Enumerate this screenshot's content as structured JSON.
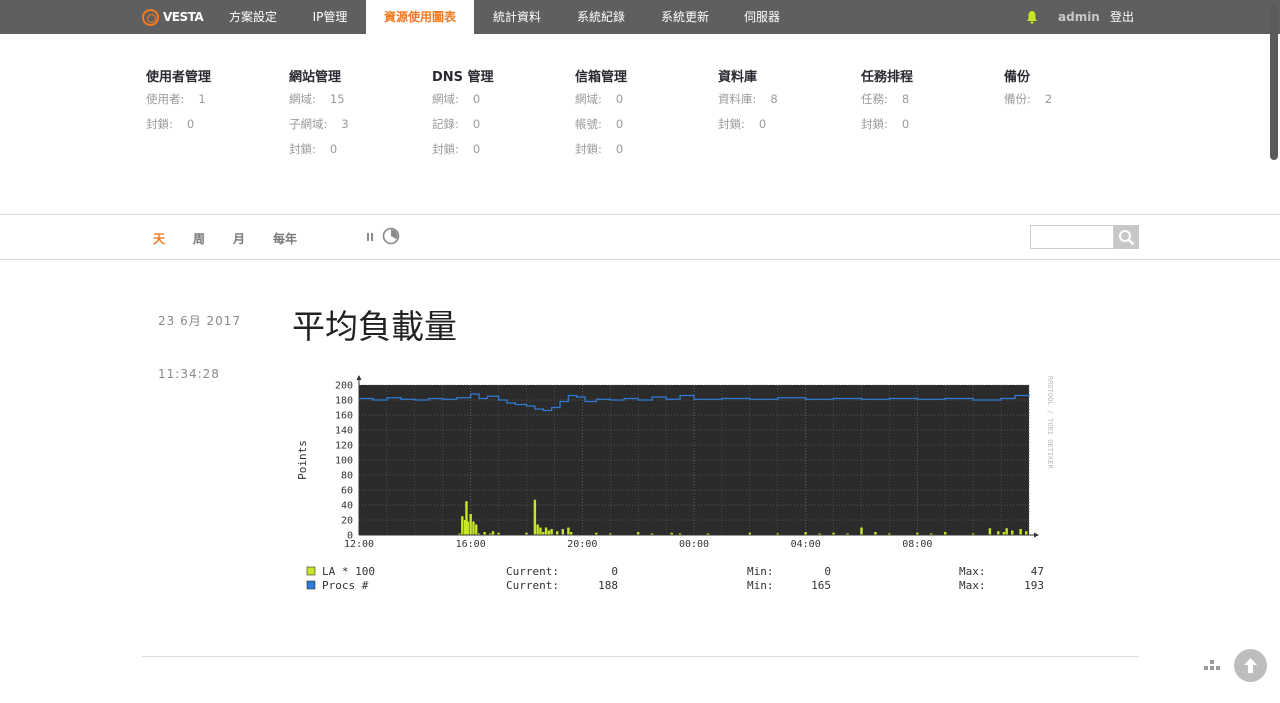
{
  "app": {
    "logo_text": "VESTA"
  },
  "nav": {
    "items": [
      {
        "label": "方案設定"
      },
      {
        "label": "IP管理"
      },
      {
        "label": "資源使用圖表",
        "active": true
      },
      {
        "label": "統計資料"
      },
      {
        "label": "系統紀錄"
      },
      {
        "label": "系統更新"
      },
      {
        "label": "伺服器"
      }
    ],
    "user": "admin",
    "logout": "登出"
  },
  "stats": [
    {
      "title": "使用者管理",
      "rows": [
        {
          "label": "使用者:",
          "value": "1"
        },
        {
          "label": "封鎖:",
          "value": "0"
        }
      ]
    },
    {
      "title": "網站管理",
      "rows": [
        {
          "label": "網域:",
          "value": "15"
        },
        {
          "label": "子網域:",
          "value": "3"
        },
        {
          "label": "封鎖:",
          "value": "0"
        }
      ]
    },
    {
      "title": "DNS 管理",
      "rows": [
        {
          "label": "網域:",
          "value": "0"
        },
        {
          "label": "記錄:",
          "value": "0"
        },
        {
          "label": "封鎖:",
          "value": "0"
        }
      ]
    },
    {
      "title": "信箱管理",
      "rows": [
        {
          "label": "網域:",
          "value": "0"
        },
        {
          "label": "帳號:",
          "value": "0"
        },
        {
          "label": "封鎖:",
          "value": "0"
        }
      ]
    },
    {
      "title": "資料庫",
      "rows": [
        {
          "label": "資料庫:",
          "value": "8"
        },
        {
          "label": "封鎖:",
          "value": "0"
        }
      ]
    },
    {
      "title": "任務排程",
      "rows": [
        {
          "label": "任務:",
          "value": "8"
        },
        {
          "label": "封鎖:",
          "value": "0"
        }
      ]
    },
    {
      "title": "備份",
      "rows": [
        {
          "label": "備份:",
          "value": "2"
        }
      ]
    }
  ],
  "toolbar": {
    "periods": [
      {
        "label": "天",
        "active": true
      },
      {
        "label": "周"
      },
      {
        "label": "月"
      },
      {
        "label": "每年"
      }
    ],
    "search_placeholder": ""
  },
  "content": {
    "date": "23  6月  2017",
    "time": "11:34:28",
    "title": "平均負載量"
  },
  "colors": {
    "accent": "#f37a20",
    "nav_bg": "#5f5f5f",
    "la_series": "#c8e624",
    "procs_series": "#2f7ad6",
    "chart_bg": "#2b2b2b"
  },
  "chart_data": {
    "type": "area",
    "ylabel": "Points",
    "ylim": [
      0,
      200
    ],
    "yticks": [
      0,
      20,
      40,
      60,
      80,
      100,
      120,
      140,
      160,
      180,
      200
    ],
    "xticks": [
      "12:00",
      "16:00",
      "20:00",
      "00:00",
      "04:00",
      "08:00"
    ],
    "xlim_hours": [
      12,
      36
    ],
    "watermark": "RRDTOOL / TOBI OETIKER",
    "series": [
      {
        "name": "LA * 100",
        "style": "bars",
        "color": "#c8e624",
        "current": "0",
        "min": "0",
        "max": "47",
        "points": [
          [
            15.6,
            2
          ],
          [
            15.7,
            25
          ],
          [
            15.8,
            20
          ],
          [
            15.85,
            45
          ],
          [
            15.9,
            18
          ],
          [
            16.0,
            28
          ],
          [
            16.1,
            18
          ],
          [
            16.2,
            14
          ],
          [
            16.3,
            2
          ],
          [
            16.5,
            4
          ],
          [
            16.7,
            2
          ],
          [
            16.8,
            5
          ],
          [
            17.0,
            3
          ],
          [
            18.0,
            3
          ],
          [
            18.3,
            47
          ],
          [
            18.4,
            14
          ],
          [
            18.5,
            10
          ],
          [
            18.6,
            4
          ],
          [
            18.7,
            10
          ],
          [
            18.8,
            6
          ],
          [
            18.9,
            8
          ],
          [
            19.1,
            5
          ],
          [
            19.3,
            8
          ],
          [
            19.5,
            10
          ],
          [
            19.6,
            4
          ],
          [
            20.5,
            3
          ],
          [
            21.0,
            2
          ],
          [
            22.0,
            4
          ],
          [
            22.5,
            2
          ],
          [
            23.2,
            3
          ],
          [
            23.5,
            2
          ],
          [
            24.5,
            2
          ],
          [
            26.0,
            3
          ],
          [
            27.0,
            2
          ],
          [
            28.0,
            4
          ],
          [
            28.5,
            2
          ],
          [
            29.0,
            3
          ],
          [
            29.5,
            2
          ],
          [
            30.0,
            10
          ],
          [
            30.5,
            4
          ],
          [
            31.0,
            2
          ],
          [
            32.0,
            3
          ],
          [
            32.5,
            2
          ],
          [
            33.0,
            4
          ],
          [
            34.0,
            2
          ],
          [
            34.6,
            9
          ],
          [
            34.9,
            5
          ],
          [
            35.1,
            4
          ],
          [
            35.2,
            9
          ],
          [
            35.4,
            6
          ],
          [
            35.7,
            8
          ],
          [
            35.9,
            5
          ]
        ]
      },
      {
        "name": "Procs #",
        "style": "line",
        "color": "#2f7ad6",
        "current": "188",
        "min": "165",
        "max": "193",
        "points": [
          [
            12,
            182
          ],
          [
            12.5,
            180
          ],
          [
            13,
            183
          ],
          [
            13.5,
            181
          ],
          [
            14,
            180
          ],
          [
            14.5,
            182
          ],
          [
            15,
            181
          ],
          [
            15.5,
            183
          ],
          [
            16,
            188
          ],
          [
            16.3,
            182
          ],
          [
            16.6,
            185
          ],
          [
            17,
            180
          ],
          [
            17.3,
            176
          ],
          [
            17.6,
            174
          ],
          [
            18,
            172
          ],
          [
            18.3,
            168
          ],
          [
            18.6,
            166
          ],
          [
            18.9,
            170
          ],
          [
            19.2,
            178
          ],
          [
            19.5,
            186
          ],
          [
            19.8,
            184
          ],
          [
            20.1,
            178
          ],
          [
            20.5,
            181
          ],
          [
            21,
            180
          ],
          [
            21.5,
            182
          ],
          [
            22,
            180
          ],
          [
            22.5,
            184
          ],
          [
            23,
            181
          ],
          [
            23.5,
            186
          ],
          [
            24,
            181
          ],
          [
            25,
            182
          ],
          [
            26,
            181
          ],
          [
            27,
            183
          ],
          [
            28,
            181
          ],
          [
            29,
            182
          ],
          [
            30,
            181
          ],
          [
            31,
            182
          ],
          [
            32,
            181
          ],
          [
            33,
            182
          ],
          [
            34,
            180
          ],
          [
            35,
            182
          ],
          [
            35.5,
            186
          ],
          [
            36,
            188
          ]
        ]
      }
    ]
  }
}
